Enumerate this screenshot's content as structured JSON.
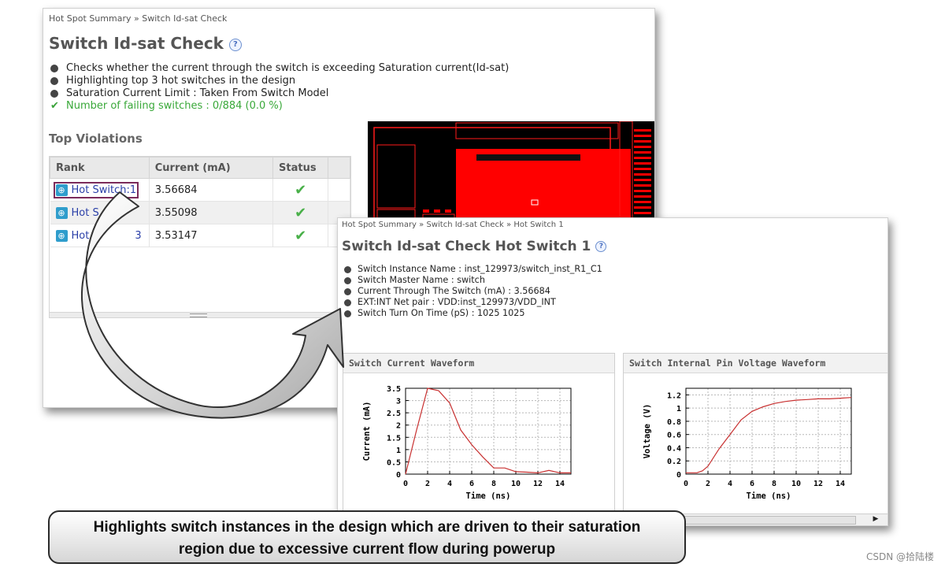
{
  "summary_panel": {
    "breadcrumb": [
      "Hot Spot Summary",
      "Switch Id-sat Check"
    ],
    "breadcrumb_sep": "»",
    "title": "Switch Id-sat Check",
    "help_glyph": "?",
    "bullets": [
      "Checks whether the current through the switch is exceeding Saturation current(Id-sat)",
      "Highlighting top 3 hot switches in the design",
      "Saturation Current Limit : Taken From Switch Model"
    ],
    "pass_line": "Number of failing switches : 0/884 (0.0 %)",
    "pass_color": "#39a839",
    "violations": {
      "heading": "Top Violations",
      "columns": [
        "Rank",
        "Current (mA)",
        "Status"
      ],
      "rows": [
        {
          "rank": "Hot Switch:1",
          "current": "3.56684",
          "status_icon": "check-icon"
        },
        {
          "rank": "Hot S",
          "current": "3.55098",
          "status_icon": "check-icon"
        },
        {
          "rank": "Hot",
          "rank_tail": "3",
          "current": "3.53147",
          "status_icon": "check-icon"
        }
      ]
    }
  },
  "detail_panel": {
    "breadcrumb": [
      "Hot Spot Summary",
      "Switch Id-sat Check",
      "Hot Switch 1"
    ],
    "breadcrumb_sep": "»",
    "title": "Switch Id-sat Check Hot Switch 1",
    "help_glyph": "?",
    "details": [
      "Switch Instance Name : inst_129973/switch_inst_R1_C1",
      "Switch Master Name : switch",
      "Current Through The Switch (mA) : 3.56684",
      "EXT:INT Net pair : VDD:inst_129973/VDD_INT",
      "Switch Turn On Time (pS) : 1025 1025"
    ]
  },
  "chart_data": [
    {
      "type": "line",
      "title": "Switch Current Waveform",
      "xlabel": "Time (ns)",
      "ylabel": "Current (mA)",
      "xlim": [
        0,
        15
      ],
      "ylim": [
        0,
        3.5
      ],
      "xticks": [
        "0",
        "2",
        "4",
        "6",
        "8",
        "10",
        "12",
        "14"
      ],
      "yticks": [
        "0",
        "0.5",
        "1",
        "1.5",
        "2",
        "2.5",
        "3",
        "3.5"
      ],
      "grid": true,
      "color": "#c83030",
      "x": [
        0,
        1,
        2,
        3,
        4,
        5,
        6,
        7,
        8,
        9,
        10,
        11,
        12,
        13,
        14,
        15
      ],
      "y": [
        0,
        1.8,
        3.5,
        3.4,
        2.9,
        1.8,
        1.2,
        0.7,
        0.25,
        0.25,
        0.1,
        0.08,
        0.05,
        0.15,
        0.05,
        0.05
      ]
    },
    {
      "type": "line",
      "title": "Switch Internal Pin Voltage Waveform",
      "xlabel": "Time (ns)",
      "ylabel": "Voltage (V)",
      "xlim": [
        0,
        15
      ],
      "ylim": [
        0,
        1.3
      ],
      "xticks": [
        "0",
        "2",
        "4",
        "6",
        "8",
        "10",
        "12",
        "14"
      ],
      "yticks": [
        "0",
        "0.2",
        "0.4",
        "0.6",
        "0.8",
        "1",
        "1.2"
      ],
      "grid": true,
      "color": "#c83030",
      "x": [
        0,
        1,
        1.5,
        2,
        3,
        4,
        5,
        6,
        7,
        8,
        9,
        10,
        11,
        12,
        13,
        14,
        15
      ],
      "y": [
        0.02,
        0.02,
        0.05,
        0.12,
        0.38,
        0.6,
        0.82,
        0.95,
        1.02,
        1.07,
        1.1,
        1.12,
        1.13,
        1.14,
        1.14,
        1.15,
        1.16
      ]
    }
  ],
  "caption": {
    "line1": "Highlights switch instances in the design which are driven to their saturation",
    "line2": "region due to excessive current flow during powerup"
  },
  "watermark": "CSDN @拾陆楼"
}
